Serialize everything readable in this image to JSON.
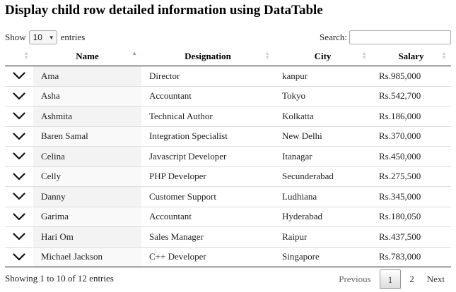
{
  "page": {
    "title": "Display child row detailed information using DataTable"
  },
  "length_control": {
    "prefix": "Show",
    "value": "10",
    "suffix": "entries"
  },
  "search": {
    "label": "Search:",
    "value": ""
  },
  "table": {
    "columns": [
      "",
      "Name",
      "Designation",
      "City",
      "Salary"
    ],
    "sorted_column": "Name",
    "sort_direction": "ascending",
    "rows": [
      {
        "name": "Ama",
        "designation": "Director",
        "city": "kanpur",
        "salary": "Rs.985,000"
      },
      {
        "name": "Asha",
        "designation": "Accountant",
        "city": "Tokyo",
        "salary": "Rs.542,700"
      },
      {
        "name": "Ashmita",
        "designation": "Technical Author",
        "city": "Kolkatta",
        "salary": "Rs.186,000"
      },
      {
        "name": "Baren Samal",
        "designation": "Integration Specialist",
        "city": "New Delhi",
        "salary": "Rs.370,000"
      },
      {
        "name": "Celina",
        "designation": "Javascript Developer",
        "city": "Itanagar",
        "salary": "Rs.450,000"
      },
      {
        "name": "Celly",
        "designation": "PHP Developer",
        "city": "Secunderabad",
        "salary": "Rs.275,500"
      },
      {
        "name": "Danny",
        "designation": "Customer Support",
        "city": "Ludhiana",
        "salary": "Rs.345,000"
      },
      {
        "name": "Garima",
        "designation": "Accountant",
        "city": "Hyderabad",
        "salary": "Rs.180,050"
      },
      {
        "name": "Hari Om",
        "designation": "Sales Manager",
        "city": "Raipur",
        "salary": "Rs.437,500"
      },
      {
        "name": "Michael Jackson",
        "designation": "C++ Developer",
        "city": "Singapore",
        "salary": "Rs.783,000"
      }
    ],
    "row_control_icon": "chevron-down-icon"
  },
  "info": "Showing 1 to 10 of 12 entries",
  "pagination": {
    "previous": "Previous",
    "pages": [
      "1",
      "2"
    ],
    "current": "1",
    "next": "Next"
  },
  "colors": {
    "header_rule": "#111111",
    "row_rule": "#dddddd",
    "sorted_column_bg": "#f3f3f3",
    "sort_active": "#7f9fc8"
  }
}
